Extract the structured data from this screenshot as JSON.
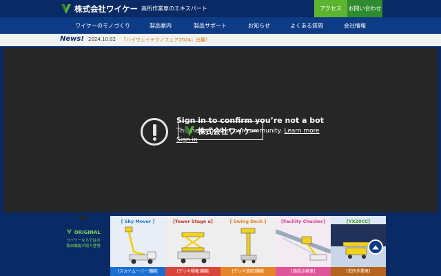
{
  "header": {
    "company_name": "株式会社ワイケー",
    "tagline": "高所作業車のエキスパート",
    "access_label": "アクセス",
    "contact_label": "お問い合わせ"
  },
  "nav": {
    "items": [
      {
        "label": "ワイケーのモノづくり"
      },
      {
        "label": "製品案内"
      },
      {
        "label": "製品サポート"
      },
      {
        "label": "お知らせ"
      },
      {
        "label": "よくある質問"
      },
      {
        "label": "会社情報"
      }
    ]
  },
  "news": {
    "label": "News!",
    "date": "2024.10.02",
    "text": "『ハイウェイテクノフェア2024』出展！"
  },
  "video": {
    "title": "Sign in to confirm you’re not a bot",
    "desc": "This helps protect our community.",
    "learn_more": "Learn more",
    "signin": "Sign in",
    "overlay_logo_text": "株式会社ワイケー"
  },
  "original": {
    "title": "ORIGINAL",
    "desc_line1": "ワイケーならではの",
    "desc_line2": "独自機能が続々登場"
  },
  "products": [
    {
      "title": "[ Sky Mover ]",
      "foot": "[スカイムーバー]機能",
      "title_color": "#1a6fd1",
      "foot_color": "#1a6fd1",
      "bg": "#e9eef6"
    },
    {
      "title": "[Tower Stage α]",
      "foot": "[デッキ積載]機能",
      "title_color": "#c0392b",
      "foot_color": "#d9443b",
      "bg": "#eeeeee"
    },
    {
      "title": "[ Swing Deck ]",
      "foot": "[デッキ旋回]機能",
      "title_color": "#e67e22",
      "foot_color": "#e8862a",
      "bg": "#eeeeee"
    },
    {
      "title": "[Facility Checker]",
      "foot": "[施設点検車]",
      "title_color": "#d63f8c",
      "foot_color": "#e05599",
      "bg": "#f3eaf2"
    },
    {
      "title": "[YX20CC]",
      "foot": "[低所作業車]",
      "title_color": "#3a9d23",
      "foot_color": "#b5651d",
      "bg": "#dfe8f5"
    }
  ],
  "colors": {
    "brand_navy": "#0a2a66",
    "nav_blue": "#0d3b86",
    "brand_green": "#5cb531"
  }
}
